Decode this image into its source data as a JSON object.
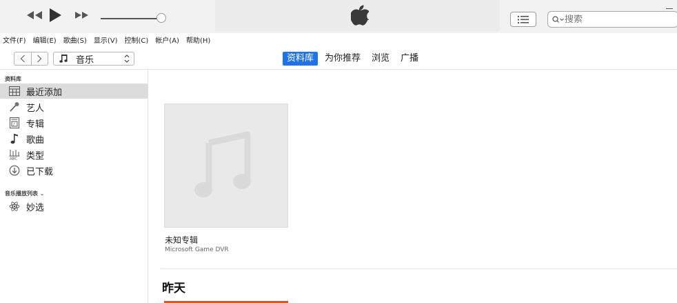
{
  "topbar": {
    "search": {
      "placeholder": "搜索"
    }
  },
  "menubar": {
    "items": [
      "文件(F)",
      "编辑(E)",
      "歌曲(S)",
      "显示(V)",
      "控制(C)",
      "帐户(A)",
      "帮助(H)"
    ]
  },
  "nav": {
    "media_kind": "音乐",
    "tabs": [
      {
        "label": "资料库",
        "active": true
      },
      {
        "label": "为你推荐",
        "active": false
      },
      {
        "label": "浏览",
        "active": false
      },
      {
        "label": "广播",
        "active": false
      }
    ]
  },
  "sidebar": {
    "library_title": "资料库",
    "library_items": [
      {
        "label": "最近添加",
        "icon": "recently-added-icon",
        "selected": true
      },
      {
        "label": "艺人",
        "icon": "microphone-icon",
        "selected": false
      },
      {
        "label": "专辑",
        "icon": "album-icon",
        "selected": false
      },
      {
        "label": "歌曲",
        "icon": "music-note-icon",
        "selected": false
      },
      {
        "label": "类型",
        "icon": "genre-icon",
        "selected": false
      },
      {
        "label": "已下载",
        "icon": "download-icon",
        "selected": false
      }
    ],
    "playlists_title": "音乐播放列表",
    "playlists": [
      {
        "label": "妙选",
        "icon": "genius-atom-icon"
      }
    ]
  },
  "main": {
    "album": {
      "title": "未知专辑",
      "artist": "Microsoft Game DVR"
    },
    "section_heading": "昨天"
  },
  "colors": {
    "accent": "#1f73e6",
    "selected_row": "#dcdcdc",
    "album_placeholder": "#e9e9e9"
  }
}
